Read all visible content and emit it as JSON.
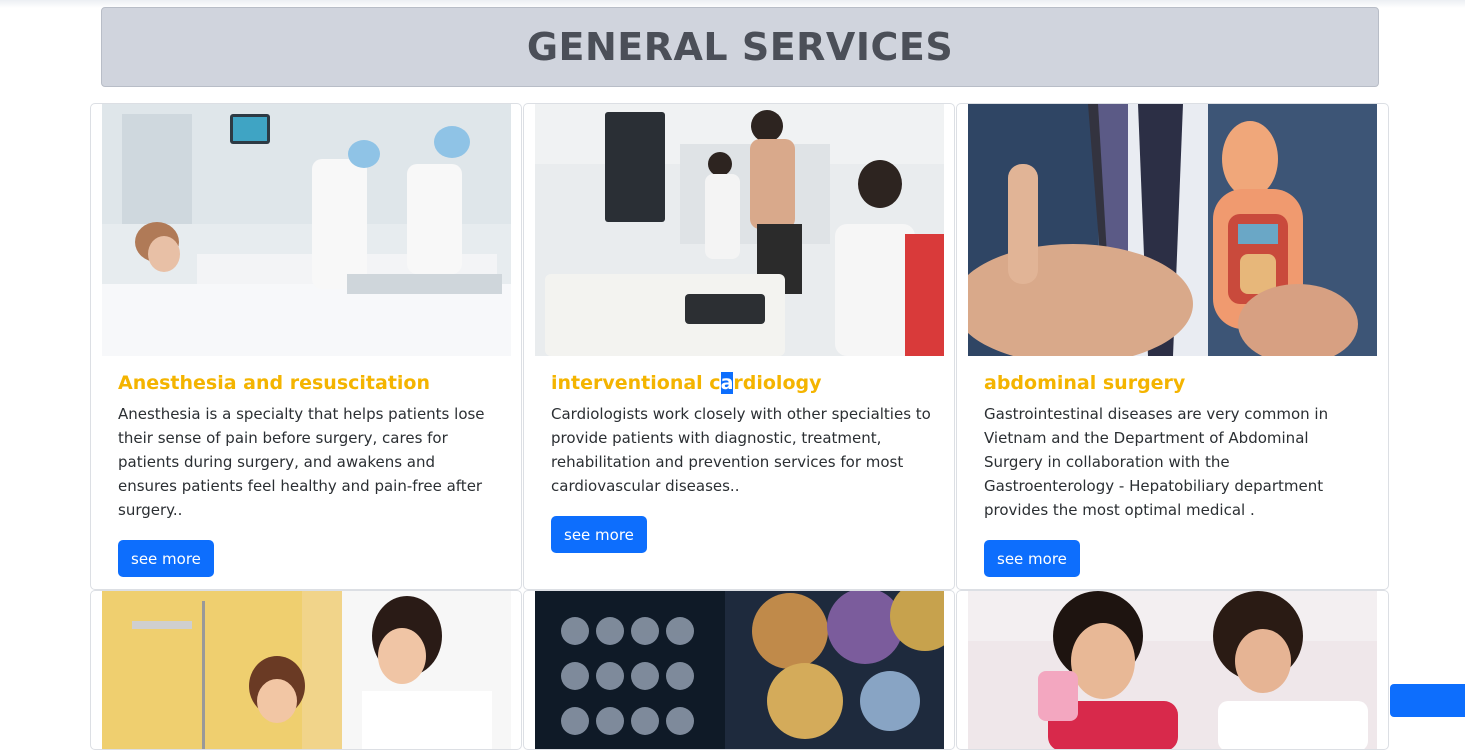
{
  "page": {
    "heading": "GENERAL SERVICES"
  },
  "colors": {
    "heading_bg": "#d0d4dd",
    "title_accent": "#f4b400",
    "button_primary": "#0d6efd"
  },
  "cards": [
    {
      "title": "Anesthesia and resuscitation",
      "description": "Anesthesia is a specialty that helps patients lose their sense of pain before surgery, cares for patients during surgery, and awakens and ensures patients feel healthy and pain-free after surgery..",
      "button_label": "see more"
    },
    {
      "title_parts": [
        "interventional c",
        "a",
        "rdiology"
      ],
      "description": "Cardiologists work closely with other specialties to provide patients with diagnostic, treatment, rehabilitation and prevention services for most cardiovascular diseases..",
      "button_label": "see more"
    },
    {
      "title": "abdominal surgery",
      "description": "Gastrointestinal diseases are very common in Vietnam and the Department of Abdominal Surgery in collaboration with the Gastroenterology - Hepatobiliary department provides the most optimal medical .",
      "button_label": "see more"
    }
  ]
}
